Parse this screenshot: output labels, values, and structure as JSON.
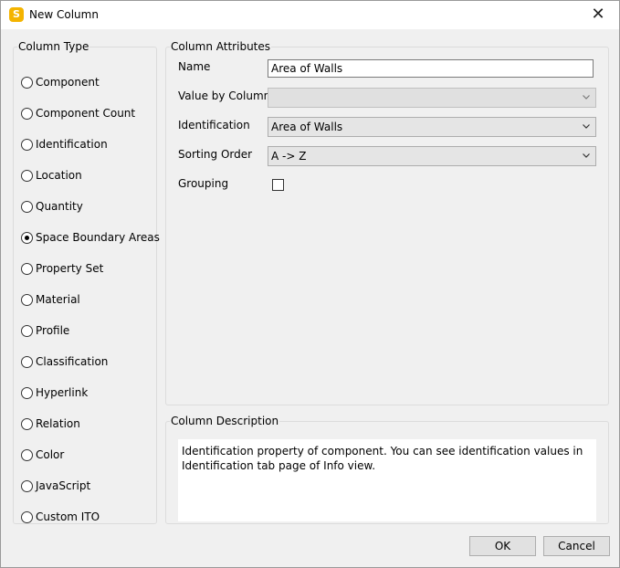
{
  "window": {
    "title": "New Column",
    "app_icon_letter": "S",
    "close_glyph": "✕"
  },
  "column_type": {
    "legend": "Column Type",
    "options": [
      {
        "label": "Component",
        "checked": false
      },
      {
        "label": "Component Count",
        "checked": false
      },
      {
        "label": "Identification",
        "checked": false
      },
      {
        "label": "Location",
        "checked": false
      },
      {
        "label": "Quantity",
        "checked": false
      },
      {
        "label": "Space Boundary Areas",
        "checked": true
      },
      {
        "label": "Property Set",
        "checked": false
      },
      {
        "label": "Material",
        "checked": false
      },
      {
        "label": "Profile",
        "checked": false
      },
      {
        "label": "Classification",
        "checked": false
      },
      {
        "label": "Hyperlink",
        "checked": false
      },
      {
        "label": "Relation",
        "checked": false
      },
      {
        "label": "Color",
        "checked": false
      },
      {
        "label": "JavaScript",
        "checked": false
      },
      {
        "label": "Custom ITO",
        "checked": false
      }
    ]
  },
  "column_attributes": {
    "legend": "Column Attributes",
    "name_label": "Name",
    "name_value": "Area of Walls",
    "value_by_column_label": "Value by Column",
    "value_by_column_value": "",
    "identification_label": "Identification",
    "identification_value": "Area of Walls",
    "sorting_order_label": "Sorting Order",
    "sorting_order_value": "A -> Z",
    "grouping_label": "Grouping",
    "grouping_checked": false
  },
  "column_description": {
    "legend": "Column Description",
    "text": "Identification property of component. You can see identification values in Identification tab page of Info view."
  },
  "buttons": {
    "ok": "OK",
    "cancel": "Cancel"
  }
}
